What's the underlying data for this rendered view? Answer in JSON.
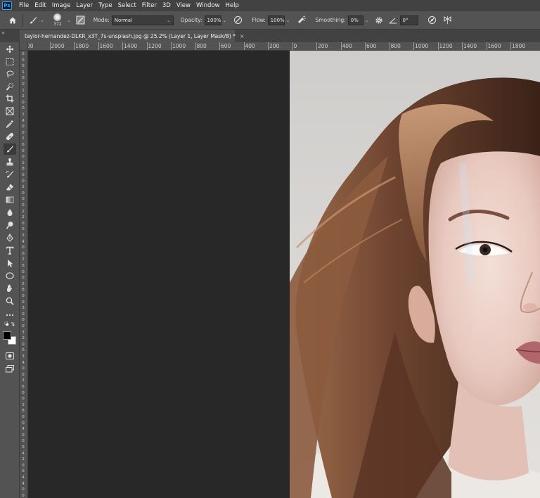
{
  "app": {
    "logo": "Ps"
  },
  "menu": [
    "File",
    "Edit",
    "Image",
    "Layer",
    "Type",
    "Select",
    "Filter",
    "3D",
    "View",
    "Window",
    "Help"
  ],
  "options": {
    "brush_size": "372",
    "mode_label": "Mode:",
    "mode_value": "Normal",
    "opacity_label": "Opacity:",
    "opacity_value": "100%",
    "flow_label": "Flow:",
    "flow_value": "100%",
    "smoothing_label": "Smoothing:",
    "smoothing_value": "0%",
    "angle_value": "0°"
  },
  "document": {
    "tab_title": "taylor-hernandez-DLKR_x3T_7s-unsplash.jpg @ 25.2% (Layer 1, Layer Mask/8) *",
    "close_glyph": "×"
  },
  "tools": [
    "move-tool",
    "marquee-tool",
    "lasso-tool",
    "quick-selection-tool",
    "crop-tool",
    "frame-tool",
    "eyedropper-tool",
    "healing-brush-tool",
    "brush-tool",
    "clone-stamp-tool",
    "history-brush-tool",
    "eraser-tool",
    "gradient-tool",
    "blur-tool",
    "dodge-tool",
    "pen-tool",
    "type-tool",
    "path-selection-tool",
    "ellipse-tool",
    "hand-tool",
    "zoom-tool",
    "more-tools",
    "default-colors",
    "color-swatches",
    "quick-mask",
    "screen-mode"
  ],
  "ruler_top": [
    "00",
    "2000",
    "1800",
    "1600",
    "1400",
    "1200",
    "1000",
    "800",
    "600",
    "400",
    "200",
    "0",
    "200",
    "400",
    "600",
    "800",
    "1000",
    "1200",
    "1400",
    "1600",
    "1800"
  ],
  "ruler_left": [
    "0",
    "0",
    "0",
    "1",
    "0",
    "0",
    "1",
    "2",
    "0",
    "0",
    "1",
    "4",
    "0",
    "0",
    "1",
    "6",
    "0",
    "0",
    "1",
    "8",
    "0",
    "0",
    "2",
    "0",
    "0",
    "0",
    "2",
    "2",
    "0",
    "0",
    "2",
    "4",
    "0",
    "0",
    "2",
    "6",
    "0",
    "0",
    "2",
    "8",
    "0",
    "0",
    "3",
    "0",
    "0",
    "0",
    "3",
    "2",
    "0",
    "0",
    "3",
    "4",
    "0",
    "0",
    "3",
    "6",
    "0",
    "0",
    "3",
    "8",
    "0",
    "0",
    "4",
    "0",
    "0",
    "0",
    "4",
    "2",
    "0",
    "0",
    "4",
    "4",
    "0",
    "0"
  ],
  "colors": {
    "foreground": "#000000",
    "background": "#ffffff",
    "pasteboard": "#282828",
    "chrome": "#535353",
    "menubar": "#424242"
  }
}
